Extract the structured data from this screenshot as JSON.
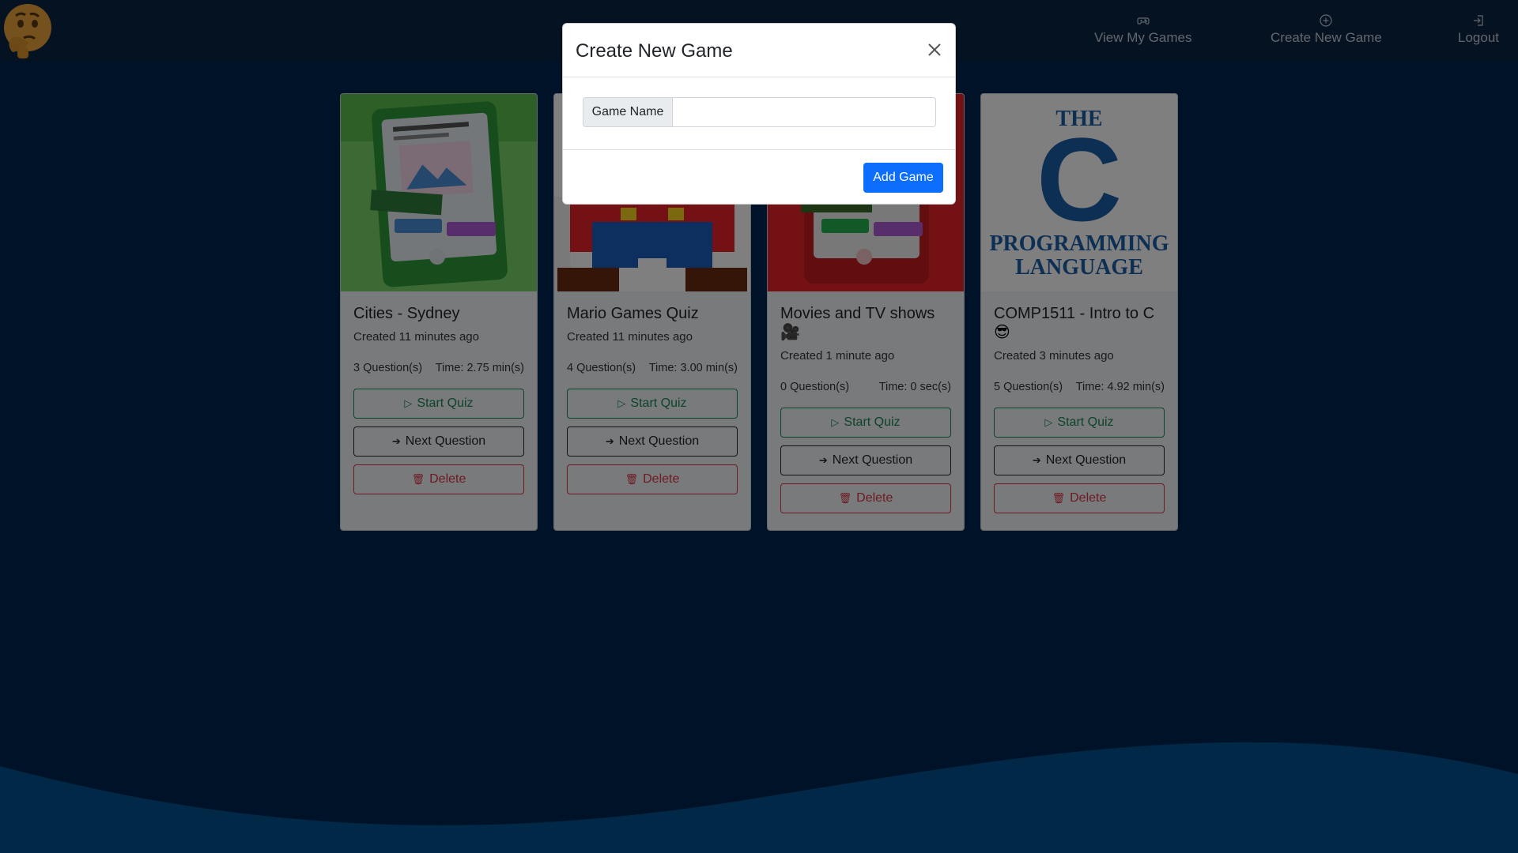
{
  "nav": {
    "items": [
      {
        "label": "View My Games",
        "icon": "controller-icon"
      },
      {
        "label": "Create New Game",
        "icon": "plus-circle-icon"
      },
      {
        "label": "Logout",
        "icon": "logout-icon"
      }
    ]
  },
  "cards": [
    {
      "title": "Cities - Sydney",
      "emoji": "",
      "created": "Created 11 minutes ago",
      "questions": "3 Question(s)",
      "time": "Time: 2.75 min(s)",
      "start_label": "Start Quiz",
      "next_label": "Next Question",
      "delete_label": "Delete"
    },
    {
      "title": "Mario Games Quiz",
      "emoji": "",
      "created": "Created 11 minutes ago",
      "questions": "4 Question(s)",
      "time": "Time: 3.00 min(s)",
      "start_label": "Start Quiz",
      "next_label": "Next Question",
      "delete_label": "Delete"
    },
    {
      "title": "Movies and TV shows",
      "emoji": "🎥",
      "created": "Created 1 minute ago",
      "questions": "0 Question(s)",
      "time": "Time: 0 sec(s)",
      "start_label": "Start Quiz",
      "next_label": "Next Question",
      "delete_label": "Delete"
    },
    {
      "title": "COMP1511 - Intro to C",
      "emoji": "😎",
      "created": "Created 3 minutes ago",
      "questions": "5 Question(s)",
      "time": "Time: 4.92 min(s)",
      "start_label": "Start Quiz",
      "next_label": "Next Question",
      "delete_label": "Delete",
      "cover": {
        "line1": "THE",
        "line2": "C",
        "line3": "PROGRAMMING",
        "line4": "LANGUAGE"
      }
    }
  ],
  "modal": {
    "title": "Create New Game",
    "input_label": "Game Name",
    "input_value": "",
    "input_placeholder": "",
    "submit_label": "Add Game"
  },
  "colors": {
    "page_bg": "#01254e",
    "navbar_bg": "#0b2544",
    "wave": "#02508f",
    "primary": "#0d6efd",
    "success": "#198754",
    "danger": "#dc3545"
  }
}
